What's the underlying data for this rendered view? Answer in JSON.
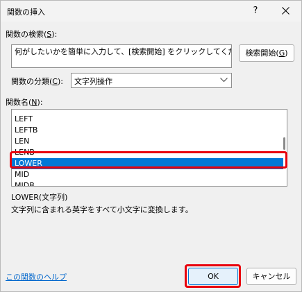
{
  "dialog": {
    "title": "関数の挿入",
    "help_glyph": "?"
  },
  "search": {
    "label": "関数の検索(",
    "label_key": "S",
    "label_end": "):",
    "value": "何がしたいかを簡単に入力して、[検索開始] をクリックしてください。",
    "button_label": "検索開始(",
    "button_key": "G",
    "button_end": ")"
  },
  "category": {
    "label": "関数の分類(",
    "label_key": "C",
    "label_end": "):",
    "selected": "文字列操作"
  },
  "function_list": {
    "label": "関数名(",
    "label_key": "N",
    "label_end": "):",
    "items": [
      "LEFT",
      "LEFTB",
      "LEN",
      "LENB",
      "LOWER",
      "MID",
      "MIDB"
    ],
    "selected": "LOWER"
  },
  "description": {
    "signature": "LOWER(文字列)",
    "text": "文字列に含まれる英字をすべて小文字に変換します。"
  },
  "footer": {
    "help_link": "この関数のヘルプ",
    "ok_label": "OK",
    "cancel_label": "キャンセル"
  },
  "colors": {
    "selection": "#0078d7",
    "highlight": "#e8000d",
    "link": "#0066cc"
  }
}
